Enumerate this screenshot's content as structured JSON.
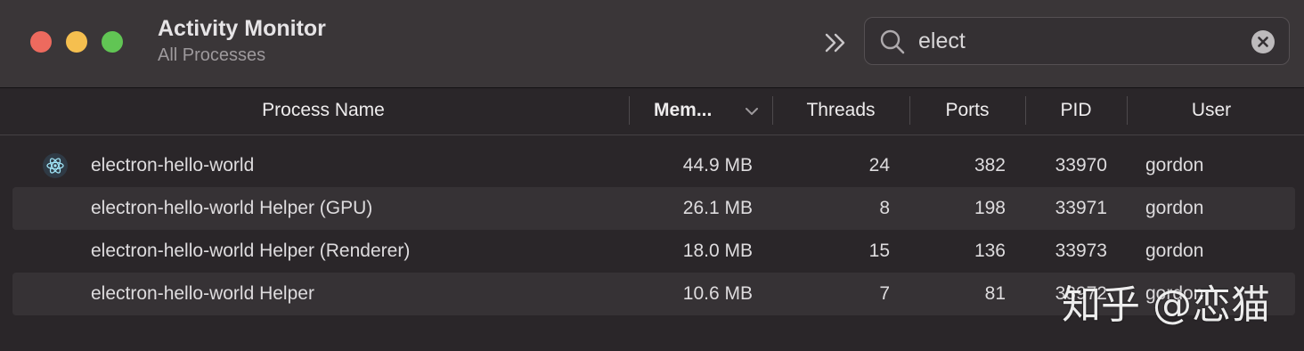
{
  "window": {
    "title": "Activity Monitor",
    "subtitle": "All Processes"
  },
  "toolbar": {
    "overflow_icon": "double-chevron-right-icon"
  },
  "search": {
    "value": "elect",
    "icon": "search-icon",
    "clear_icon": "clear-icon"
  },
  "table": {
    "columns": [
      {
        "key": "name",
        "label": "Process Name"
      },
      {
        "key": "memory",
        "label": "Mem...",
        "sorted": true,
        "sort_direction": "descending"
      },
      {
        "key": "threads",
        "label": "Threads"
      },
      {
        "key": "ports",
        "label": "Ports"
      },
      {
        "key": "pid",
        "label": "PID"
      },
      {
        "key": "user",
        "label": "User"
      }
    ],
    "rows": [
      {
        "name": "electron-hello-world",
        "memory": "44.9 MB",
        "threads": "24",
        "ports": "382",
        "pid": "33970",
        "user": "gordon",
        "icon": "electron-app-icon"
      },
      {
        "name": "electron-hello-world Helper (GPU)",
        "memory": "26.1 MB",
        "threads": "8",
        "ports": "198",
        "pid": "33971",
        "user": "gordon"
      },
      {
        "name": "electron-hello-world Helper (Renderer)",
        "memory": "18.0 MB",
        "threads": "15",
        "ports": "136",
        "pid": "33973",
        "user": "gordon"
      },
      {
        "name": "electron-hello-world Helper",
        "memory": "10.6 MB",
        "threads": "7",
        "ports": "81",
        "pid": "33972",
        "user": "gordon"
      }
    ]
  },
  "watermark": "知乎 @恋猫",
  "colors": {
    "close": "#ed6a5e",
    "minimize": "#f5bf4f",
    "maximize": "#61c554",
    "titlebar": "#3a3638",
    "window_bg": "#2a2629",
    "alt_row": "#363235"
  }
}
